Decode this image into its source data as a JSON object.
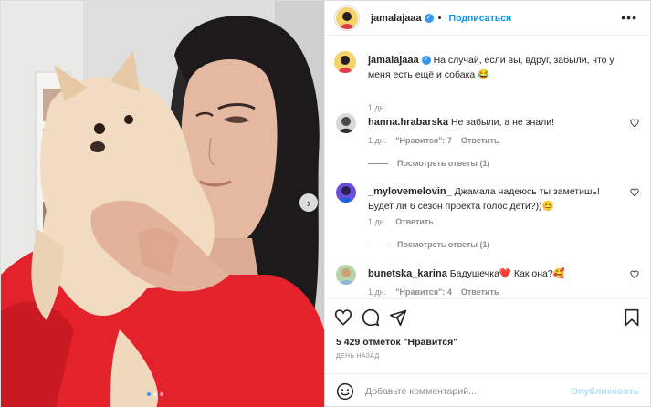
{
  "post": {
    "author": {
      "username": "jamalajaaa",
      "verified_icon": "verified-badge-icon",
      "follow_label": "Подписаться",
      "separator": "•"
    },
    "more_icon": "more-horizontal-icon",
    "photo": {
      "carousel_next": "›",
      "slides": 3,
      "active_slide": 1
    },
    "caption": {
      "username": "jamalajaaa",
      "text": "На случай, если вы, вдруг, забыли, что у меня есть ещё и собака 😂",
      "time": "1 дн."
    },
    "comments": [
      {
        "username": "hanna.hrabarska",
        "text": "Не забыли, а не знали!",
        "time": "1 дн.",
        "likes": "\"Нравится\": 7",
        "reply_label": "Ответить",
        "view_replies": "Посмотреть ответы (1)"
      },
      {
        "username": "_mylovemelovin_",
        "text": "Джамала надеюсь ты заметишь! Будет ли 6 сезон проекта голос дети?))😊",
        "time": "1 дн.",
        "reply_label": "Ответить",
        "view_replies": "Посмотреть ответы (1)"
      },
      {
        "username": "bunetska_karina",
        "text": "Бадушечка❤️ Как она?🥰",
        "time": "1 дн.",
        "likes": "\"Нравится\": 4",
        "reply_label": "Ответить"
      }
    ],
    "actions": {
      "like_icon": "heart-icon",
      "comment_icon": "comment-icon",
      "share_icon": "share-icon",
      "save_icon": "bookmark-icon"
    },
    "likes_text": "5 429 отметок \"Нравится\"",
    "date_text": "ДЕНЬ НАЗАД",
    "add_comment": {
      "emoji_icon": "emoji-icon",
      "placeholder": "Добавьте комментарий...",
      "publish_label": "Опубликовать"
    },
    "colors": {
      "accent": "#0095f6",
      "publish_disabled": "#b2dffc",
      "secondary_text": "#8e8e8e",
      "heart_red": "#e0245e"
    }
  }
}
